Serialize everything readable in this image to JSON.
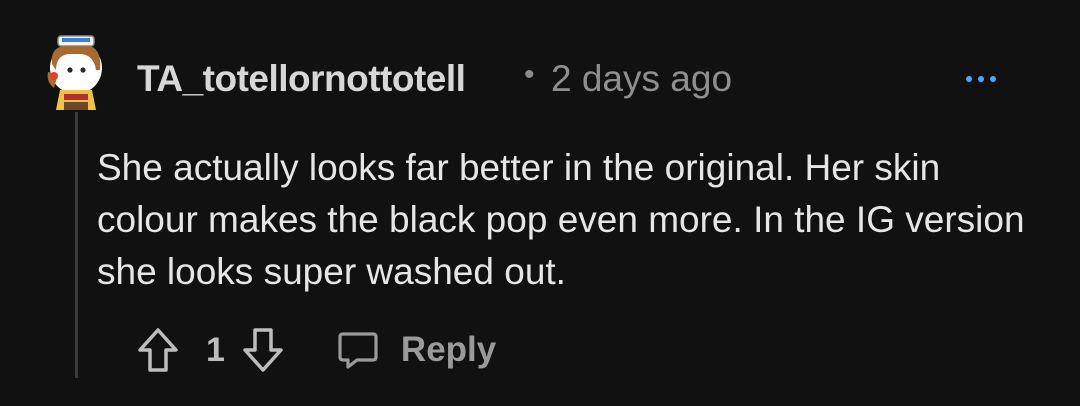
{
  "comment": {
    "username": "TA_totellornottotell",
    "separator": "•",
    "timestamp": "2 days ago",
    "body": "She actually looks far better in the original. Her skin colour makes the black pop even more. In the IG version she looks super washed out.",
    "vote_count": "1",
    "reply_label": "Reply",
    "avatar_icon": "snoo-avatar-icon",
    "more_icon": "more-options-icon",
    "upvote_icon": "upvote-arrow-icon",
    "downvote_icon": "downvote-arrow-icon",
    "reply_icon": "chat-bubble-icon"
  },
  "colors": {
    "background": "#111111",
    "accent": "#4aa6ff",
    "text": "#e6e6e6",
    "muted": "#8f8f8f"
  }
}
